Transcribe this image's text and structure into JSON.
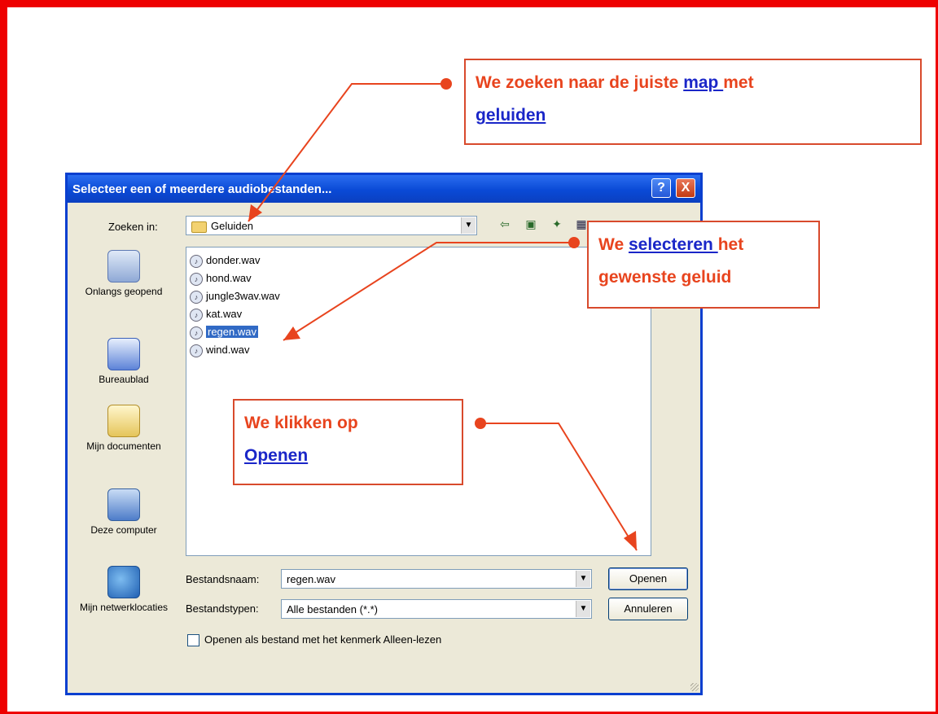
{
  "dialog": {
    "title": "Selecteer een of meerdere audiobestanden...",
    "help_label": "?",
    "close_label": "X",
    "look_in_label": "Zoeken in:",
    "look_in_value": "Geluiden",
    "places": [
      {
        "label": "Onlangs geopend",
        "icon": "recent-documents-icon"
      },
      {
        "label": "Bureaublad",
        "icon": "desktop-icon"
      },
      {
        "label": "Mijn documenten",
        "icon": "my-documents-icon"
      },
      {
        "label": "Deze computer",
        "icon": "my-computer-icon"
      },
      {
        "label": "Mijn netwerklocaties",
        "icon": "network-places-icon"
      }
    ],
    "files": [
      "donder.wav",
      "hond.wav",
      "jungle3wav.wav",
      "kat.wav",
      "regen.wav",
      "wind.wav"
    ],
    "selected_file": "regen.wav",
    "filename_label": "Bestandsnaam:",
    "filename_value": "regen.wav",
    "filetype_label": "Bestandstypen:",
    "filetype_value": "Alle bestanden (*.*)",
    "open_button": "Openen",
    "cancel_button": "Annuleren",
    "readonly_checkbox_label": "Openen als bestand met het kenmerk Alleen-lezen",
    "readonly_checked": false
  },
  "callouts": {
    "map": {
      "prefix": "We zoeken naar de juiste ",
      "link1": "map ",
      "middle": "met",
      "link2": "geluiden"
    },
    "select": {
      "prefix": "We ",
      "link": "selecteren ",
      "suffix": "het",
      "line2": "gewenste geluid"
    },
    "open": {
      "line1": "We klikken op",
      "link": "Openen"
    }
  },
  "colors": {
    "frame": "#ee0000",
    "callout_text": "#e8441e",
    "link": "#1a26c8",
    "selection": "#316ac5",
    "titlebar": "#0a4ad6"
  }
}
